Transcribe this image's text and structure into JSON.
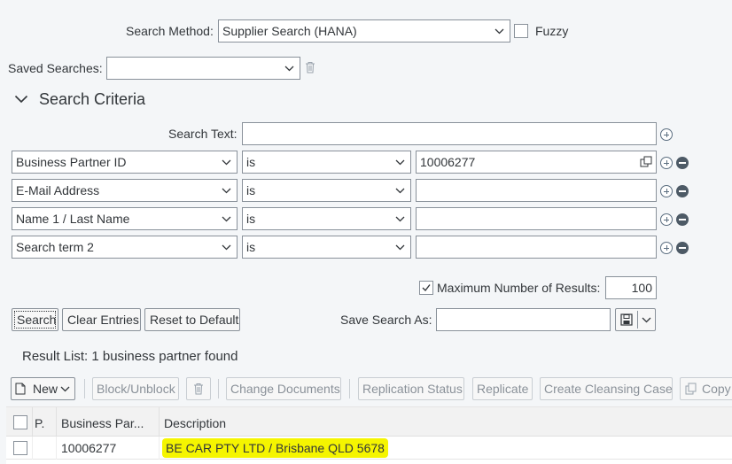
{
  "search_method": {
    "label": "Search Method:",
    "value": "Supplier Search (HANA)",
    "fuzzy_label": "Fuzzy"
  },
  "saved_searches": {
    "label": "Saved Searches:",
    "value": ""
  },
  "criteria_section": {
    "title": "Search Criteria"
  },
  "search_text": {
    "label": "Search Text:",
    "value": ""
  },
  "criteria_rows": [
    {
      "field": "Business Partner ID",
      "operator": "is",
      "value": "10006277"
    },
    {
      "field": "E-Mail Address",
      "operator": "is",
      "value": ""
    },
    {
      "field": "Name 1 / Last Name",
      "operator": "is",
      "value": ""
    },
    {
      "field": "Search term 2",
      "operator": "is",
      "value": ""
    }
  ],
  "max_results": {
    "label": "Maximum Number of Results:",
    "value": "100",
    "checked": true
  },
  "actions": {
    "search": "Search",
    "clear": "Clear Entries",
    "reset": "Reset to Default"
  },
  "save_search": {
    "label": "Save Search As:",
    "value": ""
  },
  "result": {
    "title": "Result List: 1 business partner found"
  },
  "toolbar": {
    "new": "New",
    "block": "Block/Unblock",
    "change_docs": "Change Documents",
    "replication_status": "Replication Status",
    "replicate": "Replicate",
    "cleansing": "Create Cleansing Case",
    "copy": "Copy"
  },
  "table": {
    "columns": [
      "P.",
      "Business Par...",
      "Description"
    ],
    "rows": [
      {
        "id": "10006277",
        "description": "BE CAR PTY LTD / Brisbane QLD 5678"
      }
    ]
  },
  "colors": {
    "highlight": "#f5f500",
    "accent": "#0a6ed1"
  }
}
